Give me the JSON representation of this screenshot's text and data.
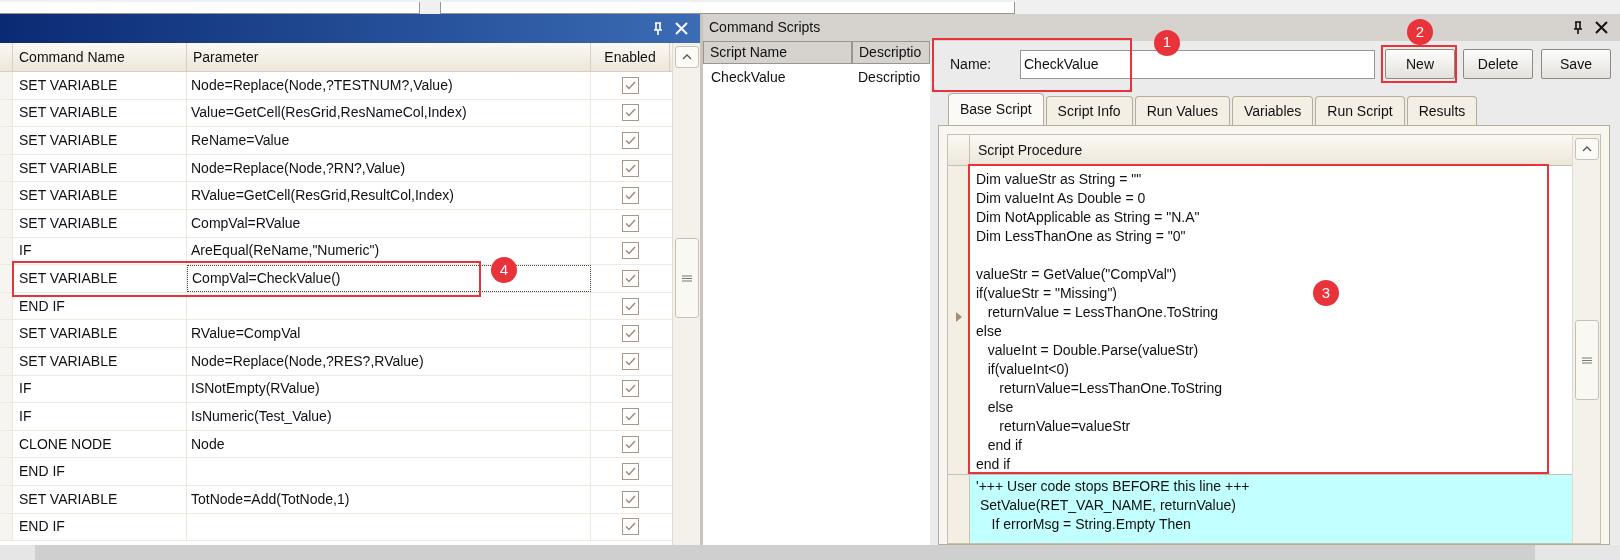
{
  "command_panel": {
    "columns": [
      {
        "label": "Command Name"
      },
      {
        "label": "Parameter"
      },
      {
        "label": "Enabled"
      }
    ],
    "rows": [
      {
        "command": "SET VARIABLE",
        "parameter": "Node=Replace(Node,?TESTNUM?,Value)",
        "enabled": true,
        "focused": false
      },
      {
        "command": "SET VARIABLE",
        "parameter": "Value=GetCell(ResGrid,ResNameCol,Index)",
        "enabled": true,
        "focused": false
      },
      {
        "command": "SET VARIABLE",
        "parameter": "ReName=Value",
        "enabled": true,
        "focused": false
      },
      {
        "command": "SET VARIABLE",
        "parameter": "Node=Replace(Node,?RN?,Value)",
        "enabled": true,
        "focused": false
      },
      {
        "command": "SET VARIABLE",
        "parameter": "RValue=GetCell(ResGrid,ResultCol,Index)",
        "enabled": true,
        "focused": false
      },
      {
        "command": "SET VARIABLE",
        "parameter": "CompVal=RValue",
        "enabled": true,
        "focused": false
      },
      {
        "command": "IF",
        "parameter": "AreEqual(ReName,\"Numeric\")",
        "enabled": true,
        "focused": false
      },
      {
        "command": "SET VARIABLE",
        "parameter": "CompVal=CheckValue()",
        "enabled": true,
        "focused": true,
        "callout": "4"
      },
      {
        "command": "END IF",
        "enabled": true,
        "focused": false
      },
      {
        "command": "SET VARIABLE",
        "parameter": "RValue=CompVal",
        "enabled": true,
        "focused": false
      },
      {
        "command": "SET VARIABLE",
        "parameter": "Node=Replace(Node,?RES?,RValue)",
        "enabled": true,
        "focused": false
      },
      {
        "command": "IF",
        "parameter": "ISNotEmpty(RValue)",
        "enabled": true,
        "focused": false
      },
      {
        "command": "IF",
        "parameter": "IsNumeric(Test_Value)",
        "enabled": true,
        "focused": false
      },
      {
        "command": "CLONE NODE",
        "parameter": "Node",
        "enabled": true,
        "focused": false
      },
      {
        "command": "END IF",
        "enabled": true,
        "focused": false
      },
      {
        "command": "SET VARIABLE",
        "parameter": "TotNode=Add(TotNode,1)",
        "enabled": true,
        "focused": false
      },
      {
        "command": "END IF",
        "enabled": true,
        "focused": false
      }
    ]
  },
  "scripts_panel": {
    "title": "Command Scripts",
    "list": {
      "columns": [
        {
          "label": "Script Name"
        },
        {
          "label": "Descriptio"
        }
      ],
      "rows": [
        {
          "name": "CheckValue",
          "description": "Descriptio"
        }
      ]
    },
    "name": {
      "label": "Name:",
      "value": "CheckValue",
      "callout": "1"
    },
    "buttons": [
      {
        "label": "New",
        "callout": "2"
      },
      {
        "label": "Delete"
      },
      {
        "label": "Save"
      }
    ],
    "tabs": [
      {
        "label": "Base Script",
        "selected": true
      },
      {
        "label": "Script Info",
        "selected": false
      },
      {
        "label": "Run Values",
        "selected": false
      },
      {
        "label": "Variables",
        "selected": false
      },
      {
        "label": "Run Script",
        "selected": false
      },
      {
        "label": "Results",
        "selected": false
      }
    ],
    "editor": {
      "column_header": "Script Procedure",
      "callout": "3",
      "user_code": [
        [
          "Dim valueStr as String = \"\"",
          "Dim valueInt As Double = 0",
          "Dim NotApplicable as String = \"N.A\"",
          "Dim LessThanOne as String = \"0\""
        ],
        [
          "valueStr = GetValue(\"CompVal\")",
          "if(valueStr = \"Missing\")",
          "   returnValue = LessThanOne.ToString",
          "else",
          "   valueInt = Double.Parse(valueStr)",
          "   if(valueInt<0)",
          "      returnValue=LessThanOne.ToString",
          "   else",
          "      returnValue=valueStr",
          "   end if",
          "end if"
        ]
      ],
      "generated_code": [
        "'+++ User code stops BEFORE this line +++",
        " SetValue(RET_VAR_NAME, returnValue)",
        "    If errorMsg = String.Empty Then"
      ]
    }
  }
}
